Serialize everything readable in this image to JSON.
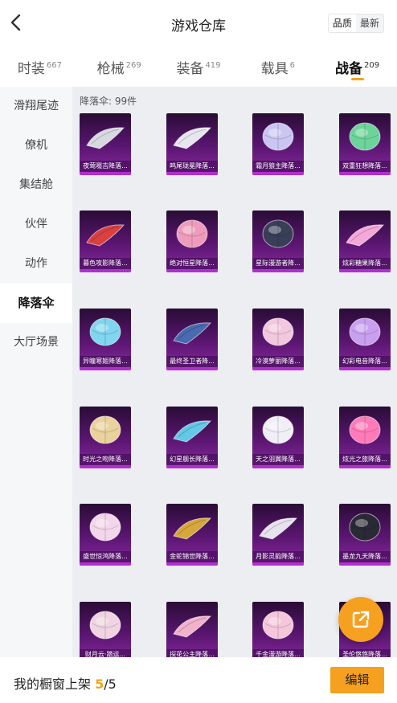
{
  "header": {
    "title": "游戏仓库",
    "sort_options": [
      "品质",
      "最新"
    ]
  },
  "tabs": [
    {
      "label": "时装",
      "count": "667"
    },
    {
      "label": "枪械",
      "count": "269"
    },
    {
      "label": "装备",
      "count": "419"
    },
    {
      "label": "载具",
      "count": "6"
    },
    {
      "label": "战备",
      "count": "209"
    }
  ],
  "sidebar": {
    "items": [
      {
        "label": "滑翔尾迹"
      },
      {
        "label": "僚机"
      },
      {
        "label": "集结舱"
      },
      {
        "label": "伙伴"
      },
      {
        "label": "动作"
      },
      {
        "label": "降落伞"
      },
      {
        "label": "大厅场景"
      }
    ]
  },
  "main": {
    "count_label": "降落伞: 99件",
    "items": [
      {
        "name": "夜莺啜吉降落...",
        "color": "#d8d8e0",
        "shape": "glider"
      },
      {
        "name": "鸣尾珑冕降落...",
        "color": "#e6e6ee",
        "shape": "glider"
      },
      {
        "name": "霜月狼主降落...",
        "color": "#c9c6f2",
        "shape": "dome"
      },
      {
        "name": "双重狂想降落...",
        "color": "#6cd49a",
        "shape": "dome"
      },
      {
        "name": "暮色攻影降落...",
        "color": "#d94040",
        "shape": "glider"
      },
      {
        "name": "绝对恒星降落...",
        "color": "#ef9cbc",
        "shape": "dome"
      },
      {
        "name": "星际漫游者降...",
        "color": "#3a3f58",
        "shape": "dome"
      },
      {
        "name": "炫彩糖果降落...",
        "color": "#f4a8d8",
        "shape": "glider"
      },
      {
        "name": "异瞳寒姬降落...",
        "color": "#7fd6ee",
        "shape": "dome"
      },
      {
        "name": "最终圣卫者降...",
        "color": "#4a6ab0",
        "shape": "glider"
      },
      {
        "name": "冷漠萝丽降落...",
        "color": "#f2c8de",
        "shape": "dome"
      },
      {
        "name": "幻彩电音降落...",
        "color": "#c9a0f0",
        "shape": "dome"
      },
      {
        "name": "时光之吻降落...",
        "color": "#ead29c",
        "shape": "dome"
      },
      {
        "name": "幻星舰长降落...",
        "color": "#64c8e6",
        "shape": "glider"
      },
      {
        "name": "天之羽翼降落...",
        "color": "#f0eef6",
        "shape": "dome"
      },
      {
        "name": "炫光之旅降落...",
        "color": "#ff7ab8",
        "shape": "dome"
      },
      {
        "name": "盛世惊鸿降落...",
        "color": "#f4d6ea",
        "shape": "dome"
      },
      {
        "name": "金蛇锦世降落...",
        "color": "#d6a83c",
        "shape": "glider"
      },
      {
        "name": "月影灵韵降落...",
        "color": "#e6e2ee",
        "shape": "glider"
      },
      {
        "name": "墨龙九天降落...",
        "color": "#2a2a36",
        "shape": "dome"
      },
      {
        "name": "财月云·踏运...",
        "color": "#f0d4e2",
        "shape": "dome"
      },
      {
        "name": "探花公主降落...",
        "color": "#f2b2cc",
        "shape": "glider"
      },
      {
        "name": "千金漫游降落...",
        "color": "#f6c6da",
        "shape": "dome"
      },
      {
        "name": "圣伦悠悠降落...",
        "color": "#f6d2b6",
        "shape": "dome"
      }
    ]
  },
  "bottombar": {
    "showcase_label": "我的橱窗上架",
    "showcase_current": "5",
    "showcase_total": "/5",
    "edit_label": "编辑"
  },
  "colors": {
    "accent": "#f6a020",
    "item_bg": "#5b1672",
    "item_bar": "#b12fd0"
  },
  "icons": {
    "back": "chevron-left-icon",
    "share": "share-external-icon"
  }
}
